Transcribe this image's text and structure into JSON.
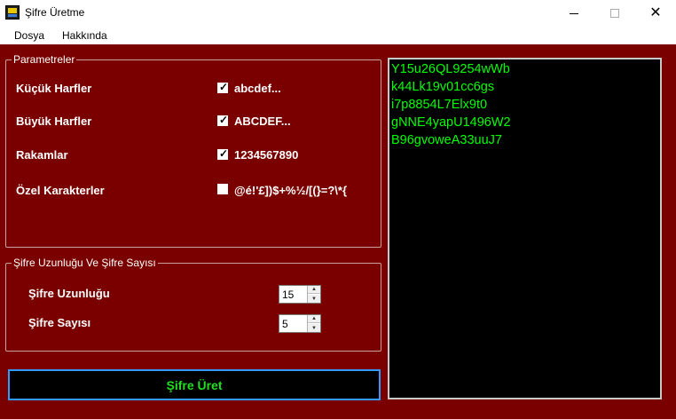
{
  "window": {
    "title": "Şifre Üretme",
    "close_glyph": "✕"
  },
  "menu": {
    "items": [
      "Dosya",
      "Hakkında"
    ]
  },
  "parameters": {
    "legend": "Parametreler",
    "options": [
      {
        "label": "Küçük Harfler",
        "checked": true,
        "chars": "abcdef..."
      },
      {
        "label": "Büyük Harfler",
        "checked": true,
        "chars": "ABCDEF..."
      },
      {
        "label": "Rakamlar",
        "checked": true,
        "chars": "1234567890"
      },
      {
        "label": "Özel Karakterler",
        "checked": false,
        "chars": "@é!'£])$+%½/[(}=?\\*{"
      }
    ]
  },
  "length_group": {
    "legend": "Şifre Uzunluğu Ve Şifre Sayısı",
    "length_label": "Şifre Uzunluğu",
    "length_value": "15",
    "count_label": "Şifre Sayısı",
    "count_value": "5",
    "spin_up_glyph": "▲",
    "spin_down_glyph": "▼"
  },
  "generate_button": "Şifre Üret",
  "output": {
    "lines": [
      "Y15u26QL9254wWb",
      "k44Lk19v01cc6gs",
      "i7p8854L7Elx9t0",
      "gNNE4yapU1496W2",
      "B96gvoweA33uuJ7"
    ]
  },
  "colors": {
    "background": "#7a0000",
    "output_text": "#00ff00",
    "button_text": "#22dd22",
    "button_border": "#3399ff"
  }
}
